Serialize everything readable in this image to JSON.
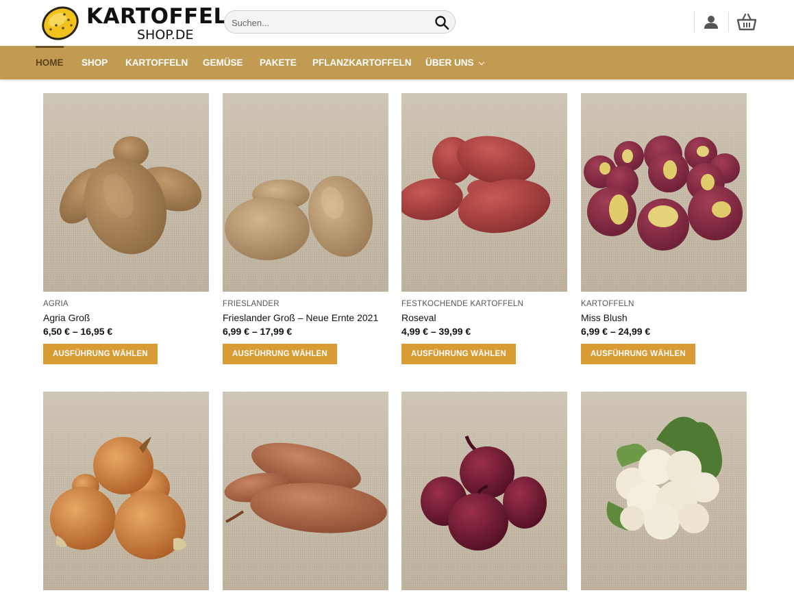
{
  "logo": {
    "line1": "KARTOFFEL",
    "line2": "SHOP.DE"
  },
  "search": {
    "placeholder": "Suchen...",
    "icon": "search-icon"
  },
  "header_icons": {
    "user": "user-icon",
    "cart": "basket-icon"
  },
  "colors": {
    "nav_bg": "#c29b52",
    "button_bg": "#d99b34",
    "active_nav": "#5a4218"
  },
  "nav": {
    "items": [
      {
        "label": "HOME",
        "active": true
      },
      {
        "label": "SHOP"
      },
      {
        "label": "KARTOFFELN"
      },
      {
        "label": "GEMÜSE"
      },
      {
        "label": "PAKETE"
      },
      {
        "label": "PFLANZKARTOFFELN"
      },
      {
        "label": "ÜBER UNS",
        "dropdown": true
      }
    ]
  },
  "products": [
    {
      "category": "AGRIA",
      "name": "Agria Groß",
      "price": "6,50 € – 16,95 €",
      "button": "AUSFÜHRUNG WÄHLEN",
      "image": "potatoes-agria"
    },
    {
      "category": "FRIESLANDER",
      "name": "Frieslander Groß – Neue Ernte 2021",
      "price": "6,99 € – 17,99 €",
      "button": "AUSFÜHRUNG WÄHLEN",
      "image": "potatoes-frieslander"
    },
    {
      "category": "FESTKOCHENDE KARTOFFELN",
      "name": "Roseval",
      "price": "4,99 € – 39,99 €",
      "button": "AUSFÜHRUNG WÄHLEN",
      "image": "potatoes-roseval"
    },
    {
      "category": "KARTOFFELN",
      "name": "Miss Blush",
      "price": "6,99 € – 24,99 €",
      "button": "AUSFÜHRUNG WÄHLEN",
      "image": "potatoes-miss-blush"
    },
    {
      "image": "onions-yellow"
    },
    {
      "image": "sweet-potatoes"
    },
    {
      "image": "onions-red"
    },
    {
      "image": "cauliflower"
    }
  ]
}
